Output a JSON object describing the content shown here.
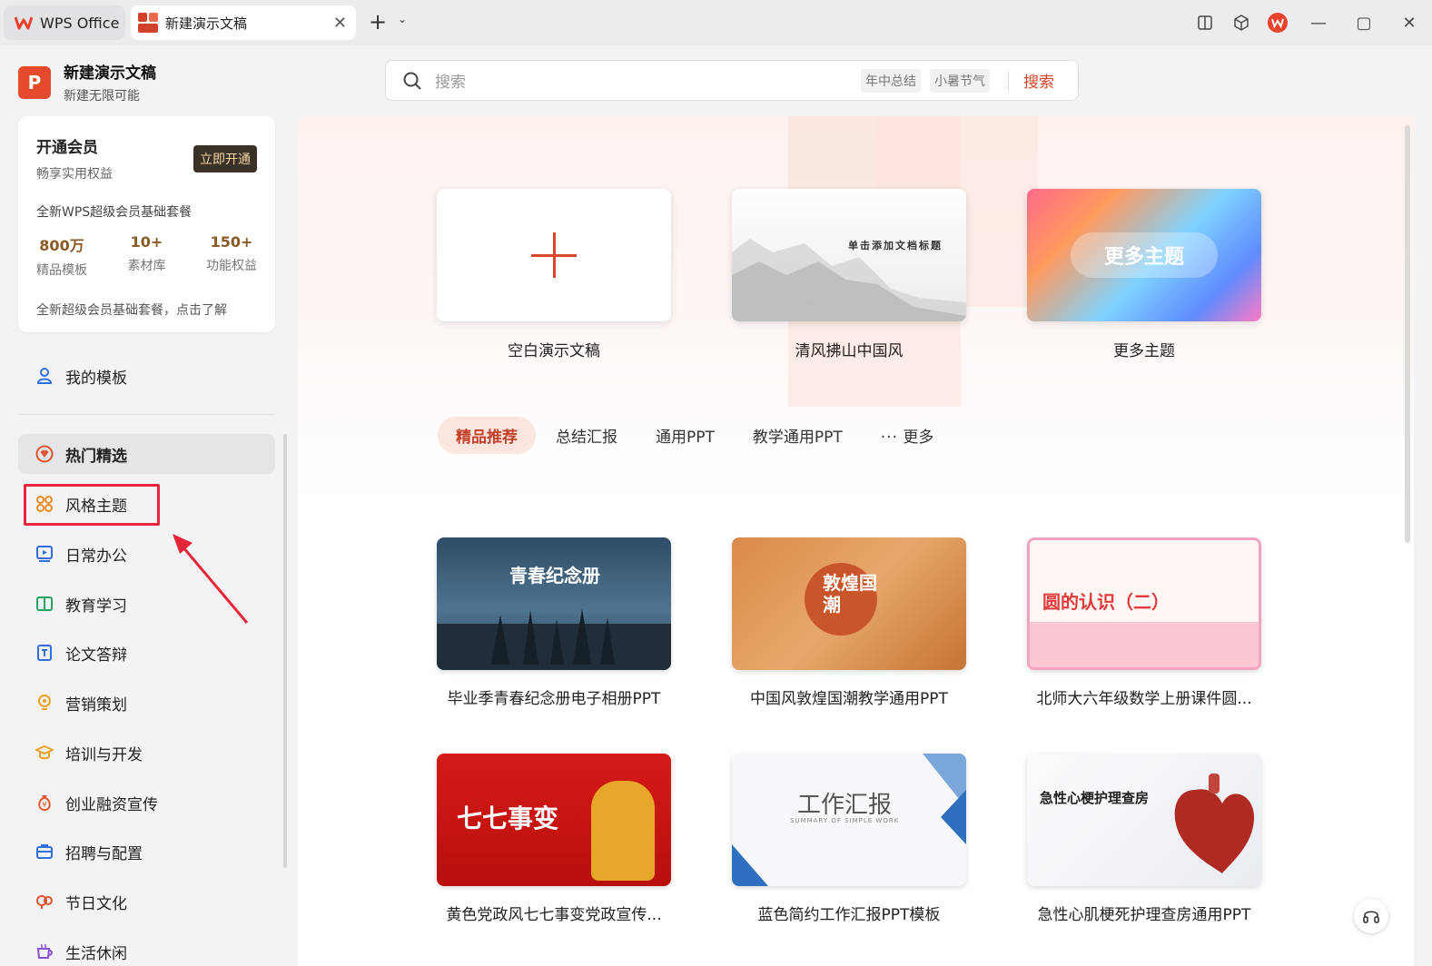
{
  "titlebar": {
    "app_tab_label": "WPS Office",
    "doc_tab_label": "新建演示文稿",
    "colors": {
      "accent": "#e8412c",
      "bar": "#ececef"
    }
  },
  "sidebar": {
    "app_title": "新建演示文稿",
    "app_subtitle": "新建无限可能",
    "logo_letter": "P",
    "vip": {
      "title": "开通会员",
      "subtitle": "畅享实用权益",
      "button": "立即开通",
      "package": "全新WPS超级会员基础套餐",
      "stats": [
        {
          "value": "800万",
          "label": "精品模板"
        },
        {
          "value": "10+",
          "label": "素材库"
        },
        {
          "value": "150+",
          "label": "功能权益"
        }
      ],
      "footer": "全新超级会员基础套餐，点击了解"
    },
    "items": [
      {
        "label": "我的模板",
        "icon": "user-icon"
      },
      {
        "label": "热门精选",
        "icon": "diamond-icon"
      },
      {
        "label": "风格主题",
        "icon": "grid-flower-icon"
      },
      {
        "label": "日常办公",
        "icon": "monitor-icon"
      },
      {
        "label": "教育学习",
        "icon": "book-icon"
      },
      {
        "label": "论文答辩",
        "icon": "document-icon"
      },
      {
        "label": "营销策划",
        "icon": "lightbulb-icon"
      },
      {
        "label": "培训与开发",
        "icon": "graduation-cap-icon"
      },
      {
        "label": "创业融资宣传",
        "icon": "money-bag-icon"
      },
      {
        "label": "招聘与配置",
        "icon": "briefcase-icon"
      },
      {
        "label": "节日文化",
        "icon": "lantern-icon"
      },
      {
        "label": "生活休闲",
        "icon": "coffee-icon"
      }
    ]
  },
  "search": {
    "placeholder": "搜索",
    "chips": [
      "年中总结",
      "小暑节气"
    ],
    "button": "搜索"
  },
  "main": {
    "top_cards": [
      {
        "label": "空白演示文稿"
      },
      {
        "label": "清风拂山中国风",
        "thumb_title": "单击添加文档标题"
      },
      {
        "label": "更多主题",
        "thumb_text": "更多主题"
      }
    ],
    "tabs": [
      "精品推荐",
      "总结汇报",
      "通用PPT",
      "教学通用PPT"
    ],
    "tab_more": "更多",
    "templates": [
      {
        "label": "毕业季青春纪念册电子相册PPT",
        "thumb_text": "青春纪念册"
      },
      {
        "label": "中国风敦煌国潮教学通用PPT",
        "thumb_text": "敦煌国潮"
      },
      {
        "label": "北师大六年级数学上册课件圆...",
        "thumb_text": "圆的认识（二）"
      },
      {
        "label": "黄色党政风七七事变党政宣传...",
        "thumb_text": "七七事变"
      },
      {
        "label": "蓝色简约工作汇报PPT模板",
        "thumb_text": "工作汇报",
        "thumb_sub": "SUMMARY OF SIMPLE WORK"
      },
      {
        "label": "急性心肌梗死护理查房通用PPT",
        "thumb_text": "急性心梗护理查房"
      }
    ]
  }
}
